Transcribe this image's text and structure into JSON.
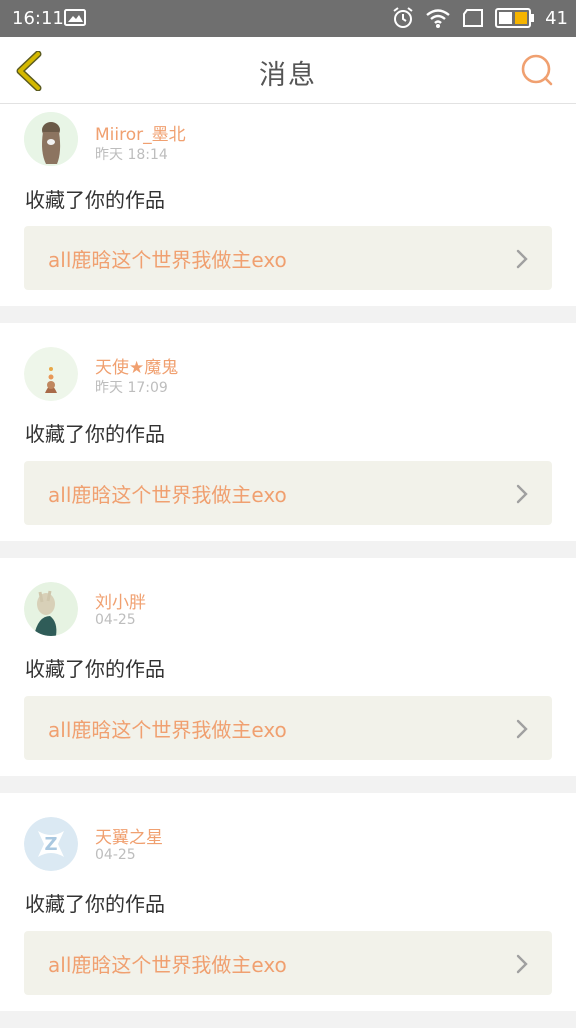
{
  "status_bar": {
    "time": "16:11",
    "battery": "41"
  },
  "nav": {
    "title": "消息",
    "back_icon": "chevron-left-icon",
    "search_icon": "search-icon"
  },
  "colors": {
    "accent": "#f0a070",
    "back_arrow": "#d4b800",
    "card_link_bg": "#f2f2ea"
  },
  "messages": [
    {
      "user": "Miiror_墨北",
      "time": "昨天  18:14",
      "action": "收藏了你的作品",
      "work_title": "all鹿晗这个世界我做主exo"
    },
    {
      "user": "天使★魔鬼",
      "time": "昨天  17:09",
      "action": "收藏了你的作品",
      "work_title": "all鹿晗这个世界我做主exo"
    },
    {
      "user": "刘小胖",
      "time": "04-25",
      "action": "收藏了你的作品",
      "work_title": "all鹿晗这个世界我做主exo"
    },
    {
      "user": "天翼之星",
      "time": "04-25",
      "action": "收藏了你的作品",
      "work_title": "all鹿晗这个世界我做主exo"
    }
  ]
}
